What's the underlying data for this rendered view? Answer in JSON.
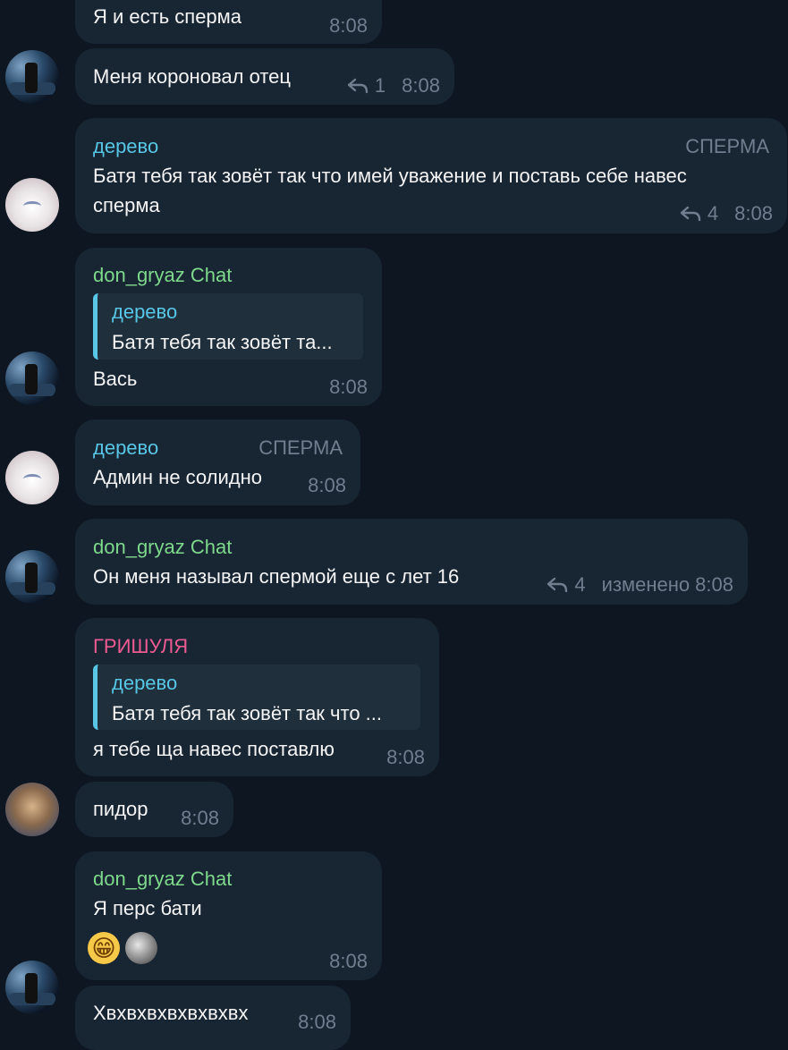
{
  "messages": [
    {
      "id": "m1",
      "text": "Я и есть сперма",
      "time": "8:08"
    },
    {
      "id": "m2",
      "text": "Меня короновал отец",
      "replies": "1",
      "time": "8:08"
    },
    {
      "id": "m3",
      "sender": "дерево",
      "rank": "СПЕРМА",
      "line1": "Батя тебя так зовёт так что  имей уважение и поставь себе навес",
      "line2": "сперма",
      "replies": "4",
      "time": "8:08"
    },
    {
      "id": "m4",
      "sender": "don_gryaz Chat",
      "quote_sender": "дерево",
      "quote_text": "Батя тебя так зовёт та...",
      "text": "Вась",
      "time": "8:08"
    },
    {
      "id": "m5",
      "sender": "дерево",
      "rank": "СПЕРМА",
      "text": "Админ не солидно",
      "time": "8:08"
    },
    {
      "id": "m6",
      "sender": "don_gryaz Chat",
      "text": "Он меня называл спермой еще с лет 16",
      "replies": "4",
      "edited": "изменено",
      "time": "8:08"
    },
    {
      "id": "m7",
      "sender": "ГРИШУЛЯ",
      "quote_sender": "дерево",
      "quote_text": "Батя тебя так зовёт так что ...",
      "text": "я тебе ща навес поставлю",
      "time": "8:08"
    },
    {
      "id": "m8",
      "text": "пидор",
      "time": "8:08"
    },
    {
      "id": "m9",
      "sender": "don_gryaz Chat",
      "text": "Я перс бати",
      "reaction_emoji": "😁",
      "time": "8:08"
    },
    {
      "id": "m10",
      "text": "Хвхвхвхвхвхвхвх",
      "time": "8:08"
    }
  ],
  "colors": {
    "background": "#0e1621",
    "bubble": "#182533",
    "green": "#7ed98c",
    "cyan": "#58c7e6",
    "pink": "#ee5b92",
    "meta": "#6f7f90"
  }
}
